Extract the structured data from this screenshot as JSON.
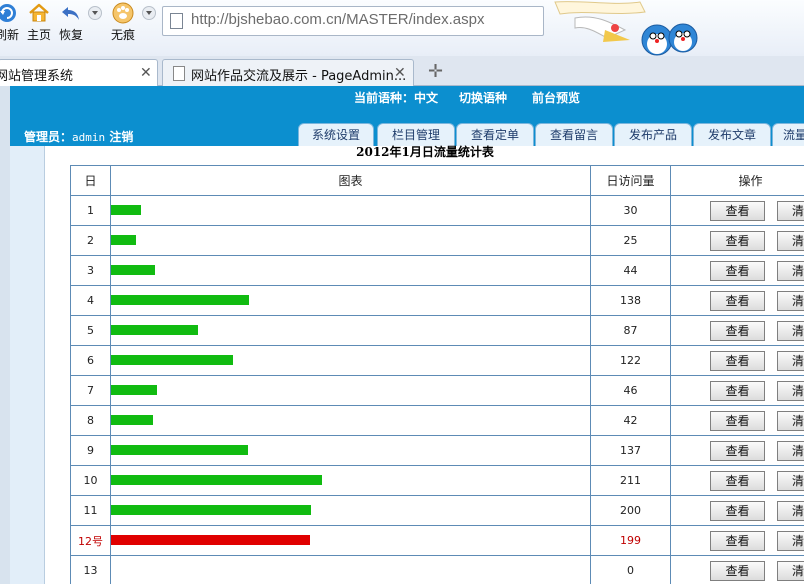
{
  "browser": {
    "buttons": [
      {
        "label": "刷新",
        "icon": "refresh-icon"
      },
      {
        "label": "主页",
        "icon": "home-icon"
      },
      {
        "label": "恢复",
        "icon": "undo-icon"
      },
      {
        "label": "无痕",
        "icon": "paw-icon"
      }
    ],
    "url": "http://bjshebao.com.cn/MASTER/index.aspx",
    "tabs": [
      {
        "title": "网站管理系统",
        "active": true
      },
      {
        "title": "网站作品交流及展示 - PageAdmin...",
        "active": false
      }
    ],
    "new_tab_icon": "plus-icon"
  },
  "cms": {
    "language_current_label": "当前语种：中文",
    "switch_language": "切换语种",
    "frontend_preview": "前台预览",
    "admin_label": "管理员：",
    "admin_name": "admin",
    "logout": "注销",
    "nav_tabs": [
      "系统设置",
      "栏目管理",
      "查看定单",
      "查看留言",
      "发布产品",
      "发布文章",
      "流量"
    ]
  },
  "stats": {
    "caption": "2012年1月日流量统计表",
    "columns": [
      "日",
      "图表",
      "日访问量",
      "操作"
    ],
    "view_button": "查看",
    "clear_button": "清",
    "max_visits": 480,
    "rows": [
      {
        "day": "1",
        "visits": 30,
        "highlight": false
      },
      {
        "day": "2",
        "visits": 25,
        "highlight": false
      },
      {
        "day": "3",
        "visits": 44,
        "highlight": false
      },
      {
        "day": "4",
        "visits": 138,
        "highlight": false
      },
      {
        "day": "5",
        "visits": 87,
        "highlight": false
      },
      {
        "day": "6",
        "visits": 122,
        "highlight": false
      },
      {
        "day": "7",
        "visits": 46,
        "highlight": false
      },
      {
        "day": "8",
        "visits": 42,
        "highlight": false
      },
      {
        "day": "9",
        "visits": 137,
        "highlight": false
      },
      {
        "day": "10",
        "visits": 211,
        "highlight": false
      },
      {
        "day": "11",
        "visits": 200,
        "highlight": false
      },
      {
        "day": "12号",
        "visits": 199,
        "highlight": true
      },
      {
        "day": "13",
        "visits": 0,
        "highlight": false
      }
    ],
    "colors": {
      "bar": "#11bb11",
      "bar_today": "#e00000",
      "today_text": "#c00000",
      "header_bg": "#0c8fcf"
    }
  }
}
